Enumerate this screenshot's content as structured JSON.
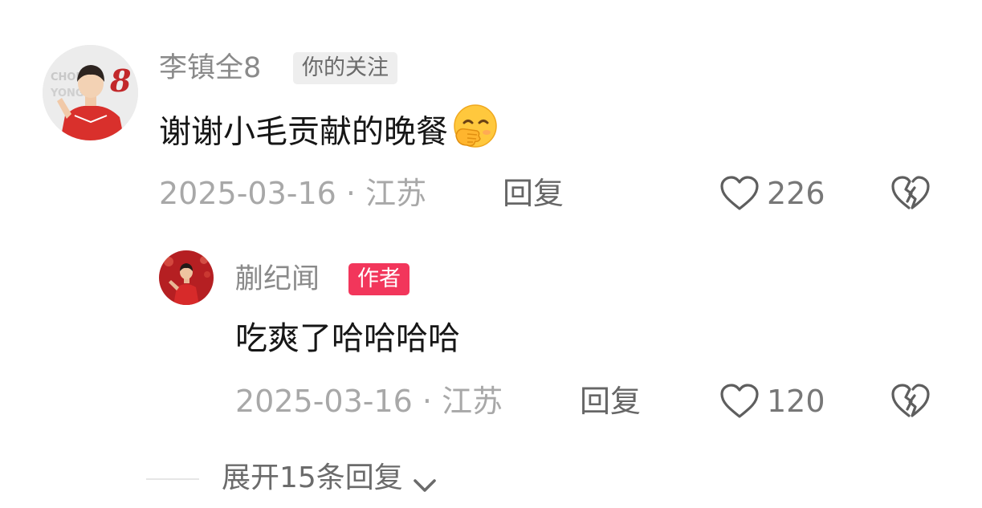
{
  "comments": [
    {
      "username": "李镇全8",
      "badge": "你的关注",
      "content": "谢谢小毛贡献的晚餐",
      "emoji_icon": "shy-smile-emoji",
      "meta": "2025-03-16 · 江苏",
      "reply_label": "回复",
      "like_count": "226",
      "avatar_icon": "user-avatar",
      "avatar_overlay_text": "8"
    },
    {
      "username": "蒯纪闻",
      "badge": "作者",
      "content": "吃爽了哈哈哈哈",
      "meta": "2025-03-16 · 江苏",
      "reply_label": "回复",
      "like_count": "120",
      "avatar_icon": "author-avatar"
    }
  ],
  "expand_replies": {
    "label": "展开15条回复",
    "icon": "chevron-down-icon"
  },
  "colors": {
    "author_badge": "#f2365b",
    "follow_badge_bg": "#eeeeee",
    "username": "#8a8a8a",
    "content": "#161616",
    "meta": "#a8a8a8"
  }
}
